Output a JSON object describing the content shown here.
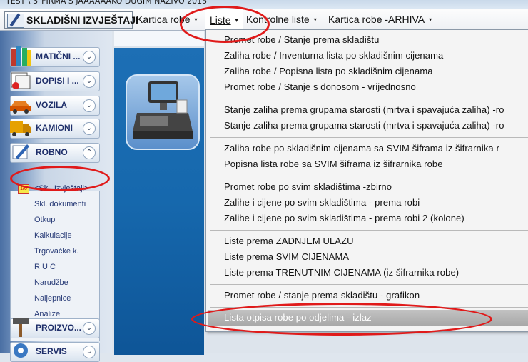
{
  "window": {
    "title": "TEST \\ 3\"FIRMA S JAAAAAAKO DUGIM NAZIVO  2015"
  },
  "menubar": {
    "items": [
      {
        "label": "SKLADIŠNI IZVJEŠTAJI"
      },
      {
        "label": "Kartica robe"
      },
      {
        "label": "Liste"
      },
      {
        "label": "Kontrolne liste"
      },
      {
        "label": "Kartica robe -ARHIVA"
      }
    ],
    "arrow": "▾"
  },
  "sidebar": {
    "categories": [
      {
        "label": "MATIČNI ...",
        "icon": "books-icon",
        "chevron": "⌄"
      },
      {
        "label": "DOPISI I ...",
        "icon": "letters-icon",
        "chevron": "⌄"
      },
      {
        "label": "VOZILA",
        "icon": "car-icon",
        "chevron": "⌄"
      },
      {
        "label": "KAMIONI",
        "icon": "truck-icon",
        "chevron": "⌄"
      },
      {
        "label": "ROBNO",
        "icon": "pencil-icon",
        "chevron": "⌃"
      },
      {
        "label": "PROIZVO...",
        "icon": "hammer-icon",
        "chevron": "⌄"
      },
      {
        "label": "SERVIS",
        "icon": "service-icon",
        "chevron": "⌄"
      }
    ],
    "robno_items": [
      "<Skl. Izvještaji>",
      "Skl. dokumenti",
      "Otkup",
      "Kalkulacije",
      "Trgovačke k.",
      "R U C",
      "Narudžbe",
      "Naljepnice",
      "Analize"
    ],
    "selected_icon_text": "1/0"
  },
  "dropdown": {
    "groups": [
      [
        "Promet robe / Stanje prema skladištu",
        "Zaliha robe  / Inventurna lista po skladišnim cijenama",
        "Zaliha robe  / Popisna lista po skladišnim cijenama",
        "Promet robe / Stanje s donosom - vrijednosno"
      ],
      [
        "Stanje zaliha prema grupama starosti (mrtva i spavajuća zaliha) -ro",
        "Stanje zaliha prema grupama starosti (mrtva i spavajuća zaliha) -ro"
      ],
      [
        "Zaliha robe  po skladišnim cijenama sa SVIM šiframa iz šifrarnika r",
        "Popisna lista robe  sa SVIM šiframa iz šifrarnika robe"
      ],
      [
        "Promet robe po svim skladištima -zbirno",
        "Zalihe i cijene po svim skladištima - prema robi",
        "Zalihe i cijene po svim skladištima - prema robi 2 (kolone)"
      ],
      [
        "Liste prema ZADNJEM ULAZU",
        "Liste prema SVIM CIJENAMA",
        "Liste prema TRENUTNIM CIJENAMA (iz šifrarnika robe)"
      ],
      [
        "Promet robe / stanje prema skladištu - grafikon"
      ]
    ],
    "highlighted": "Lista otpisa robe po odjelima - izlaz"
  },
  "colors": {
    "annotation": "#e01a1a",
    "link": "#2a3d78",
    "banner": "#1668ad"
  }
}
